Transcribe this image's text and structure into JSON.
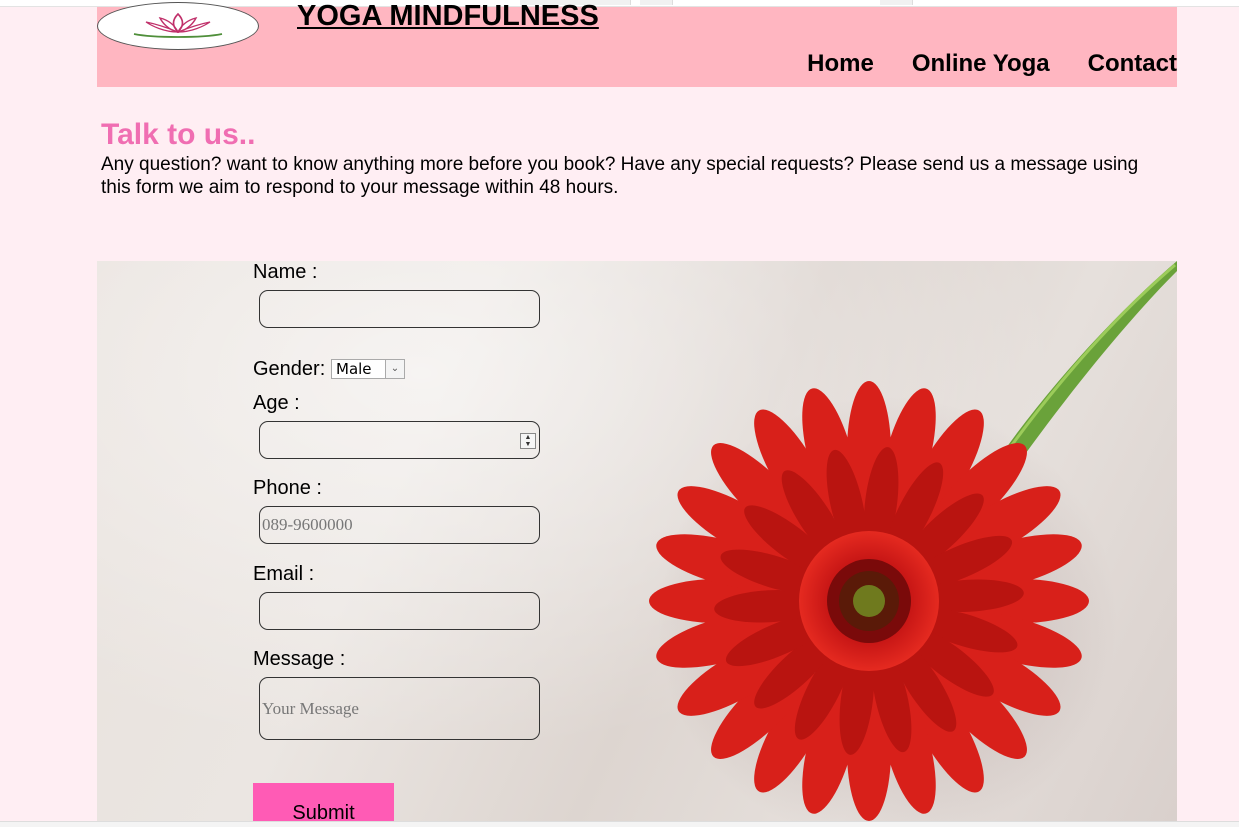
{
  "site": {
    "title": "YOGA MINDFULNESS",
    "logo_icon": "lotus-icon"
  },
  "nav": {
    "items": [
      {
        "label": "Home"
      },
      {
        "label": "Online Yoga"
      },
      {
        "label": "Contact"
      }
    ]
  },
  "contact": {
    "heading": "Talk to us..",
    "intro": "Any question? want to know anything more before you book? Have any special requests? Please send us a message using this form we aim to respond to your message within 48 hours."
  },
  "form": {
    "name_label": "Name :",
    "name_value": "",
    "gender_label": "Gender:",
    "gender_selected": "Male",
    "age_label": "Age :",
    "age_value": "",
    "phone_label": "Phone :",
    "phone_placeholder": "089-9600000",
    "email_label": "Email :",
    "email_value": "",
    "message_label": "Message :",
    "message_placeholder": "Your Message",
    "submit_label": "Submit"
  },
  "colors": {
    "page_bg": "#ffeef3",
    "header_bg": "#ffb6c1",
    "heading_pink": "#f06eb2",
    "submit_bg": "#ff5bb5"
  },
  "images": {
    "background": "red-gerbera-flower-image"
  }
}
